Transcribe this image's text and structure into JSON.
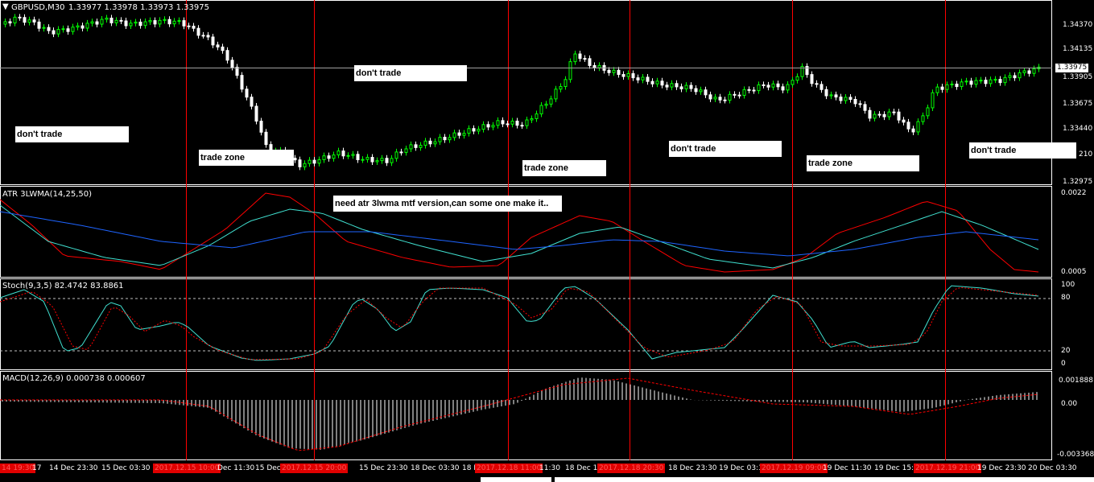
{
  "chart_header": {
    "symbol_tf": "GBPUSD,M30",
    "ohlc": "1.33977 1.33978 1.33973 1.33975"
  },
  "panes": {
    "atr_label": "ATR 3LWMA(14,25,50)",
    "stoch_label": "Stoch(9,3,5) 82.4742 83.8861",
    "macd_label": "MACD(12,26,9) 0.000738 0.000607"
  },
  "price_axis": {
    "ticks": [
      "1.34370",
      "1.34135",
      "1.33905",
      "1.33675",
      "1.33440",
      "210",
      "1.32975"
    ],
    "current_price": "1.33975"
  },
  "atr_axis": {
    "ticks": [
      "0.0022",
      "0.0005"
    ]
  },
  "stoch_axis": {
    "ticks": [
      "100",
      "80",
      "20",
      "0"
    ]
  },
  "macd_axis": {
    "ticks": [
      "0.001888",
      "0.00",
      "-0.003368"
    ]
  },
  "annotations": [
    {
      "text": "don't trade"
    },
    {
      "text": "trade zone"
    },
    {
      "text": "don't trade"
    },
    {
      "text": "trade zone"
    },
    {
      "text": "don't trade"
    },
    {
      "text": "trade zone"
    },
    {
      "text": "don't trade"
    },
    {
      "text": "need atr 3lwma mtf version,can some one make it.."
    }
  ],
  "time_axis": {
    "labels": [
      "17",
      "14 Dec 23:30",
      "15 Dec 03:30",
      "Dec 11:30",
      "15 Dec",
      "15 Dec 23:30",
      "18 Dec 03:30",
      "18 D",
      "11:30",
      "18 Dec 15",
      "18 Dec 23:30",
      "19 Dec 03:3",
      "19 Dec 11:30",
      "19 Dec 15:3",
      "19 Dec 23:30",
      "20 Dec 03:30"
    ],
    "highlighted": [
      "14 19:30",
      "2017.12.15 10:00",
      "2017.12.15 20:00",
      "2017.12.18 11:00",
      "2017.12.18 20:30",
      "2017.12.19 09:00",
      "2017.12.19 21:00"
    ]
  },
  "colors": {
    "bull": "#00ff00",
    "bear": "#ffffff",
    "atr_red": "#ff0000",
    "atr_cyan": "#40e0d0",
    "atr_blue": "#1e64ff",
    "stoch_main": "#40e0d0",
    "stoch_signal": "#ff0000",
    "separator": "#ff0000"
  },
  "icons": [
    "dropdown-triangle-icon"
  ]
}
